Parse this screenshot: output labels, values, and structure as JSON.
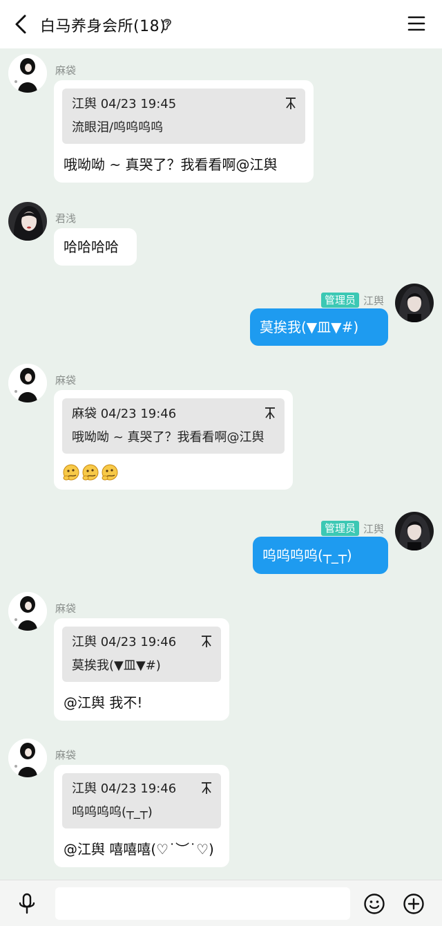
{
  "header": {
    "title": "白马养身会所(18)"
  },
  "messages": [
    {
      "sender": "麻袋",
      "quote_author": "江舆",
      "quote_time": "04/23 19:45",
      "quote_text": "流眼泪/呜呜呜呜",
      "text": "哦呦呦 ~ 真哭了？我看看啊@江舆"
    },
    {
      "sender": "君浅",
      "text": "哈哈哈哈"
    },
    {
      "sender": "江舆",
      "badge": "管理员",
      "text": "莫挨我(▼皿▼#)"
    },
    {
      "sender": "麻袋",
      "quote_author": "麻袋",
      "quote_time": "04/23 19:46",
      "quote_text": "哦呦呦 ~ 真哭了？我看看啊@江舆",
      "emojis": [
        "thinking-face-emoji",
        "thinking-face-emoji",
        "thinking-face-emoji"
      ]
    },
    {
      "sender": "江舆",
      "badge": "管理员",
      "text": "呜呜呜呜(┬_┬)"
    },
    {
      "sender": "麻袋",
      "quote_author": "江舆",
      "quote_time": "04/23 19:46",
      "quote_text": "莫挨我(▼皿▼#)",
      "text": "@江舆 我不!"
    },
    {
      "sender": "麻袋",
      "quote_author": "江舆",
      "quote_time": "04/23 19:46",
      "quote_text": "呜呜呜呜(┬_┬)",
      "text": "@江舆 嘻嘻嘻(♡˙︶˙♡)"
    }
  ],
  "input": {
    "placeholder": ""
  },
  "colors": {
    "background": "#eaf1ec",
    "own_bubble": "#1e9bf0",
    "admin_badge": "#3cc8b4"
  }
}
